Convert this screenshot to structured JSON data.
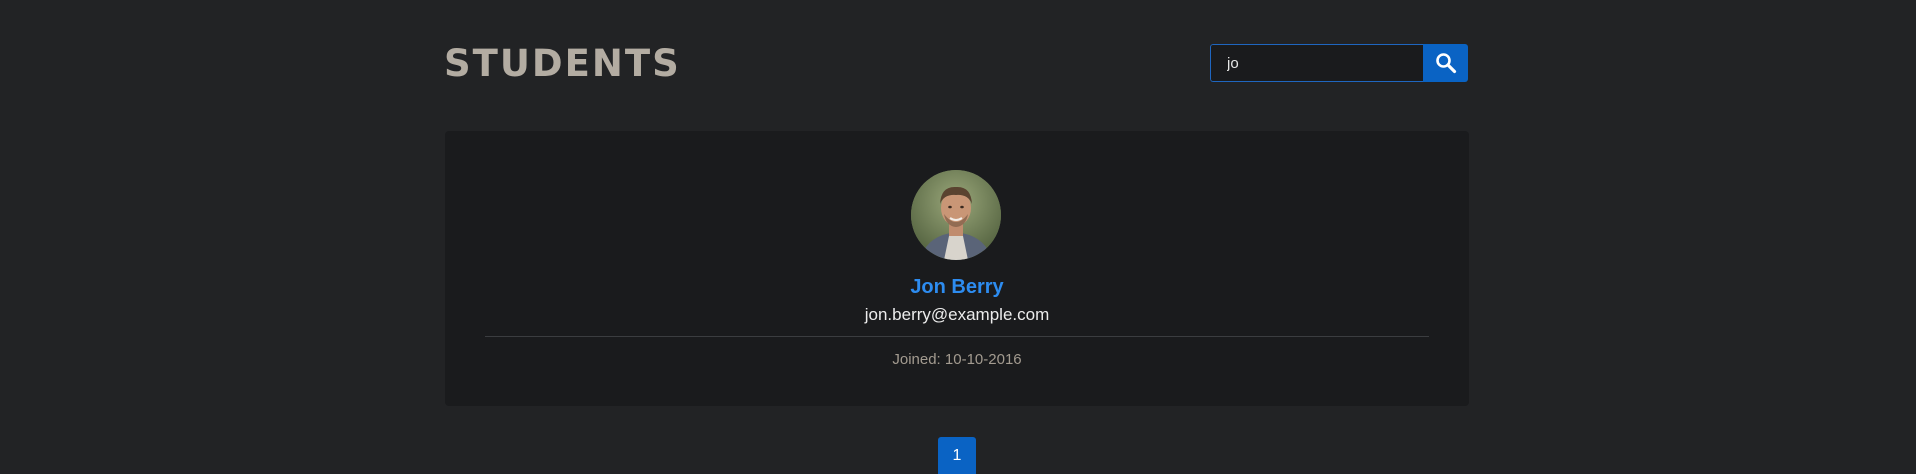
{
  "header": {
    "title": "STUDENTS"
  },
  "search": {
    "value": "jo",
    "button_icon": "search-icon"
  },
  "students": [
    {
      "name": "Jon Berry",
      "email": "jon.berry@example.com",
      "joined": "Joined: 10-10-2016"
    }
  ],
  "pagination": {
    "current_page": "1"
  },
  "colors": {
    "background": "#222325",
    "card": "#1a1b1d",
    "accent": "#0a63c4",
    "name": "#2d8cf0",
    "title": "#b3aca2"
  }
}
